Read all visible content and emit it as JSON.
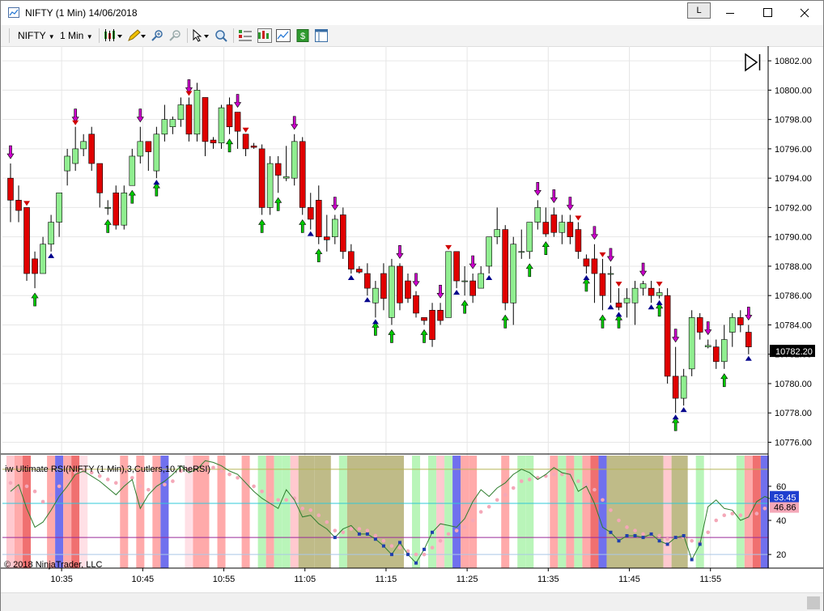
{
  "window": {
    "title": "NIFTY (1 Min)  14/06/2018",
    "link_label": "L"
  },
  "toolbar": {
    "instrument": "NIFTY",
    "interval": "1 Min"
  },
  "indicator": {
    "label": "iw Ultimate RSI(NIFTY (1 Min),3,Cutlers,10,TheRSI)",
    "current": "53.45",
    "signal": "46.86"
  },
  "copyright": "© 2018 NinjaTrader, LLC",
  "colors": {
    "up": "#90ee90",
    "down": "#e00000",
    "buy_arrow": "#00cc00",
    "sell_arrow": "#cc00cc",
    "marker_up": "#00008b",
    "marker_down": "#d00000",
    "price_tag": "#000000",
    "rsi_tag": "#1e3fcf"
  },
  "chart_data": {
    "type": "candlestick",
    "x_ticks": [
      "10:35",
      "10:45",
      "10:55",
      "11:05",
      "11:15",
      "11:25",
      "11:35",
      "11:45",
      "11:55"
    ],
    "price_ticks": [
      "10802.00",
      "10800.00",
      "10798.00",
      "10796.00",
      "10794.00",
      "10792.00",
      "10790.00",
      "10788.00",
      "10786.00",
      "10784.00",
      "10782.00",
      "10780.00",
      "10778.00",
      "10776.00"
    ],
    "last_price": "10782.20",
    "ylim": [
      10775.2,
      10803.0
    ],
    "candles": [
      [
        10794.0,
        10795.0,
        10791.0,
        10792.5
      ],
      [
        10792.5,
        10793.5,
        10791.0,
        10791.8
      ],
      [
        10792.0,
        10792.0,
        10787.0,
        10787.5
      ],
      [
        10788.5,
        10789.0,
        10786.5,
        10787.5
      ],
      [
        10787.5,
        10790.0,
        10787.5,
        10789.5
      ],
      [
        10789.5,
        10791.5,
        10789.0,
        10791.0
      ],
      [
        10791.0,
        10793.0,
        10790.0,
        10793.0
      ],
      [
        10794.5,
        10796.0,
        10793.5,
        10795.5
      ],
      [
        10795.0,
        10797.5,
        10794.5,
        10796.0
      ],
      [
        10796.0,
        10797.0,
        10795.5,
        10796.5
      ],
      [
        10797.0,
        10797.5,
        10794.5,
        10795.0
      ],
      [
        10795.0,
        10795.0,
        10792.0,
        10793.0
      ],
      [
        10792.0,
        10792.5,
        10791.5,
        10792.0
      ],
      [
        10793.0,
        10793.5,
        10790.5,
        10790.8
      ],
      [
        10790.8,
        10793.5,
        10790.5,
        10793.0
      ],
      [
        10793.5,
        10796.0,
        10793.5,
        10795.5
      ],
      [
        10795.5,
        10797.5,
        10795.0,
        10796.5
      ],
      [
        10796.5,
        10796.5,
        10794.5,
        10795.8
      ],
      [
        10794.5,
        10797.5,
        10794.0,
        10797.0
      ],
      [
        10797.0,
        10799.0,
        10796.5,
        10798.0
      ],
      [
        10797.5,
        10798.2,
        10797.0,
        10798.0
      ],
      [
        10798.0,
        10799.5,
        10797.5,
        10799.0
      ],
      [
        10799.0,
        10799.5,
        10796.5,
        10797.0
      ],
      [
        10797.0,
        10800.5,
        10796.5,
        10800.0
      ],
      [
        10799.5,
        10799.5,
        10795.5,
        10796.5
      ],
      [
        10796.6,
        10796.8,
        10796.0,
        10796.4
      ],
      [
        10796.4,
        10799.0,
        10796.0,
        10798.8
      ],
      [
        10799.0,
        10799.5,
        10797.0,
        10797.5
      ],
      [
        10798.5,
        10798.5,
        10796.0,
        10797.2
      ],
      [
        10797.0,
        10797.0,
        10795.5,
        10796.0
      ],
      [
        10796.2,
        10796.4,
        10796.0,
        10796.1
      ],
      [
        10796.0,
        10796.3,
        10791.5,
        10792.0
      ],
      [
        10792.0,
        10795.5,
        10791.5,
        10795.0
      ],
      [
        10795.0,
        10795.5,
        10793.0,
        10794.2
      ],
      [
        10794.0,
        10796.2,
        10793.8,
        10794.1
      ],
      [
        10794.0,
        10797.0,
        10793.5,
        10796.5
      ],
      [
        10796.5,
        10796.8,
        10791.5,
        10792.0
      ],
      [
        10792.0,
        10793.0,
        10790.5,
        10791.2
      ],
      [
        10792.5,
        10793.5,
        10789.5,
        10790.0
      ],
      [
        10790.0,
        10791.5,
        10789.0,
        10789.8
      ],
      [
        10790.0,
        10791.5,
        10789.5,
        10791.2
      ],
      [
        10791.5,
        10792.0,
        10788.5,
        10789.0
      ],
      [
        10789.0,
        10789.5,
        10787.5,
        10787.8
      ],
      [
        10787.8,
        10788.0,
        10787.5,
        10787.6
      ],
      [
        10787.5,
        10788.2,
        10786.0,
        10786.5
      ],
      [
        10785.5,
        10787.0,
        10784.5,
        10786.5
      ],
      [
        10787.5,
        10788.2,
        10785.0,
        10785.8
      ],
      [
        10784.5,
        10788.5,
        10784.0,
        10788.0
      ],
      [
        10788.0,
        10788.2,
        10785.0,
        10785.5
      ],
      [
        10787.0,
        10787.5,
        10785.5,
        10785.8
      ],
      [
        10786.0,
        10786.3,
        10784.5,
        10784.8
      ],
      [
        10784.5,
        10784.5,
        10784.0,
        10784.3
      ],
      [
        10785.0,
        10785.5,
        10782.5,
        10783.0
      ],
      [
        10785.0,
        10785.5,
        10784.0,
        10784.3
      ],
      [
        10784.5,
        10789.0,
        10784.5,
        10789.0
      ],
      [
        10789.0,
        10789.0,
        10786.5,
        10787.0
      ],
      [
        10787.0,
        10788.0,
        10786.0,
        10787.0
      ],
      [
        10787.0,
        10787.5,
        10785.5,
        10786.0
      ],
      [
        10786.5,
        10788.0,
        10786.5,
        10787.5
      ],
      [
        10788.0,
        10790.0,
        10787.5,
        10790.0
      ],
      [
        10790.0,
        10792.0,
        10789.5,
        10790.5
      ],
      [
        10790.5,
        10790.8,
        10785.0,
        10785.5
      ],
      [
        10785.5,
        10790.0,
        10784.0,
        10789.5
      ],
      [
        10789.0,
        10790.5,
        10788.5,
        10789.0
      ],
      [
        10789.0,
        10791.0,
        10788.5,
        10791.0
      ],
      [
        10791.0,
        10792.5,
        10790.5,
        10792.0
      ],
      [
        10791.0,
        10792.0,
        10790.0,
        10790.2
      ],
      [
        10791.5,
        10792.0,
        10790.0,
        10790.3
      ],
      [
        10790.3,
        10791.5,
        10789.5,
        10791.0
      ],
      [
        10791.0,
        10791.5,
        10789.5,
        10790.0
      ],
      [
        10790.5,
        10791.0,
        10788.5,
        10789.0
      ],
      [
        10788.5,
        10788.8,
        10787.5,
        10788.0
      ],
      [
        10788.5,
        10789.5,
        10785.5,
        10787.5
      ],
      [
        10787.5,
        10788.5,
        10785.0,
        10786.0
      ],
      [
        10787.5,
        10788.0,
        10785.5,
        10787.5
      ],
      [
        10785.5,
        10786.5,
        10785.0,
        10785.2
      ],
      [
        10785.5,
        10786.5,
        10784.5,
        10785.8
      ],
      [
        10785.5,
        10787.0,
        10784.0,
        10786.5
      ],
      [
        10786.5,
        10787.0,
        10786.0,
        10786.8
      ],
      [
        10786.5,
        10787.0,
        10785.5,
        10786.0
      ],
      [
        10786.0,
        10786.5,
        10785.8,
        10786.2
      ],
      [
        10786.0,
        10786.5,
        10780.0,
        10780.5
      ],
      [
        10780.5,
        10782.5,
        10778.0,
        10779.0
      ],
      [
        10779.0,
        10781.0,
        10778.5,
        10780.5
      ],
      [
        10781.0,
        10785.0,
        10780.5,
        10784.5
      ],
      [
        10784.5,
        10784.8,
        10783.0,
        10783.5
      ],
      [
        10782.5,
        10783.0,
        10782.4,
        10782.6
      ],
      [
        10782.5,
        10783.0,
        10781.0,
        10781.5
      ],
      [
        10781.5,
        10784.0,
        10781.0,
        10783.0
      ],
      [
        10783.5,
        10784.8,
        10782.5,
        10784.5
      ],
      [
        10784.5,
        10785.0,
        10783.5,
        10784.0
      ],
      [
        10783.5,
        10784.0,
        10782.0,
        10782.5
      ]
    ],
    "sell_arrows": [
      0,
      8,
      16,
      22,
      28,
      35,
      40,
      48,
      50,
      53,
      57,
      65,
      67,
      69,
      72,
      74,
      78,
      82,
      86,
      91
    ],
    "buy_arrows": [
      3,
      12,
      15,
      18,
      27,
      31,
      33,
      36,
      38,
      45,
      47,
      51,
      56,
      61,
      64,
      66,
      71,
      73,
      75,
      80,
      82,
      88
    ],
    "up_markers": [
      5,
      18,
      37,
      42,
      44,
      45,
      55,
      59,
      71,
      74,
      75,
      79,
      80,
      82,
      83,
      91
    ],
    "down_markers": [
      2,
      8,
      22,
      29,
      54,
      70,
      73,
      75,
      80
    ],
    "rsi": {
      "ticks": [
        "60",
        "40",
        "20"
      ],
      "ylim": [
        12,
        78
      ],
      "levels": {
        "upper": 70,
        "middle": 50,
        "lower": 30,
        "bottom": 20
      },
      "line": [
        57,
        61,
        47,
        36,
        39,
        46,
        54,
        60,
        67,
        69,
        66,
        63,
        59,
        55,
        60,
        64,
        47,
        55,
        60,
        63,
        67,
        72,
        68,
        70,
        75,
        74,
        72,
        69,
        67,
        62,
        57,
        53,
        50,
        47,
        58,
        52,
        42,
        43,
        38,
        35,
        30,
        35,
        37,
        32,
        32,
        29,
        25,
        20,
        27,
        20,
        15,
        23,
        33,
        38,
        37,
        36,
        41,
        51,
        58,
        54,
        59,
        62,
        67,
        70,
        68,
        64,
        67,
        71,
        68,
        67,
        57,
        60,
        50,
        36,
        33,
        28,
        31,
        31,
        30,
        32,
        28,
        26,
        30,
        31,
        17,
        26,
        48,
        52,
        47,
        46,
        40,
        42,
        51,
        54,
        52
      ],
      "signal": [
        62,
        57,
        60,
        57,
        51,
        55,
        60,
        63,
        68,
        69,
        68,
        66,
        64,
        62,
        62,
        65,
        60,
        58,
        60,
        61,
        63,
        69,
        70,
        71,
        70,
        71,
        69,
        67,
        65,
        62,
        60,
        57,
        55,
        52,
        52,
        53,
        47,
        46,
        43,
        39,
        34,
        33,
        35,
        35,
        34,
        31,
        28,
        25,
        24,
        22,
        20,
        20,
        24,
        28,
        32,
        34,
        36,
        40,
        45,
        48,
        52,
        55,
        59,
        63,
        64,
        65,
        66,
        67,
        67,
        67,
        63,
        61,
        58,
        52,
        46,
        40,
        36,
        34,
        32,
        32,
        31,
        29,
        30,
        30,
        28,
        27,
        33,
        40,
        43,
        44,
        43,
        42,
        44,
        47,
        49
      ]
    },
    "rsi_bands": [
      [
        0,
        0,
        "pink"
      ],
      [
        1,
        1,
        "lightred"
      ],
      [
        2,
        2,
        "red"
      ],
      [
        5,
        5,
        "lightred"
      ],
      [
        6,
        6,
        "blue"
      ],
      [
        7,
        7,
        "lightred"
      ],
      [
        8,
        8,
        "red"
      ],
      [
        9,
        9,
        "pinkl"
      ],
      [
        14,
        14,
        "lightred"
      ],
      [
        16,
        16,
        "lightred"
      ],
      [
        18,
        18,
        "lightred"
      ],
      [
        19,
        19,
        "blue"
      ],
      [
        22,
        22,
        "pinkl"
      ],
      [
        23,
        24,
        "lightred"
      ],
      [
        26,
        26,
        "lightred"
      ],
      [
        29,
        29,
        "lightred"
      ],
      [
        31,
        31,
        "green"
      ],
      [
        32,
        32,
        "lightred"
      ],
      [
        33,
        33,
        "green"
      ],
      [
        34,
        34,
        "green"
      ],
      [
        35,
        35,
        "pink"
      ],
      [
        36,
        37,
        "olive"
      ],
      [
        38,
        39,
        "olive"
      ],
      [
        41,
        41,
        "green"
      ],
      [
        42,
        48,
        "olive"
      ],
      [
        50,
        50,
        "green"
      ],
      [
        52,
        52,
        "green"
      ],
      [
        53,
        53,
        "pink"
      ],
      [
        54,
        54,
        "green"
      ],
      [
        55,
        55,
        "blue"
      ],
      [
        56,
        56,
        "lightred"
      ],
      [
        57,
        57,
        "lightred"
      ],
      [
        61,
        61,
        "lightred"
      ],
      [
        63,
        63,
        "green"
      ],
      [
        64,
        64,
        "green"
      ],
      [
        67,
        67,
        "lightred"
      ],
      [
        68,
        68,
        "green"
      ],
      [
        69,
        69,
        "lightred"
      ],
      [
        70,
        70,
        "green"
      ],
      [
        71,
        71,
        "lightred"
      ],
      [
        72,
        72,
        "red"
      ],
      [
        73,
        73,
        "blue"
      ],
      [
        74,
        80,
        "olive"
      ],
      [
        81,
        81,
        "pink"
      ],
      [
        82,
        83,
        "olive"
      ],
      [
        85,
        85,
        "green"
      ],
      [
        90,
        90,
        "green"
      ],
      [
        91,
        91,
        "lightred"
      ],
      [
        92,
        92,
        "red"
      ],
      [
        93,
        93,
        "blue"
      ]
    ]
  }
}
